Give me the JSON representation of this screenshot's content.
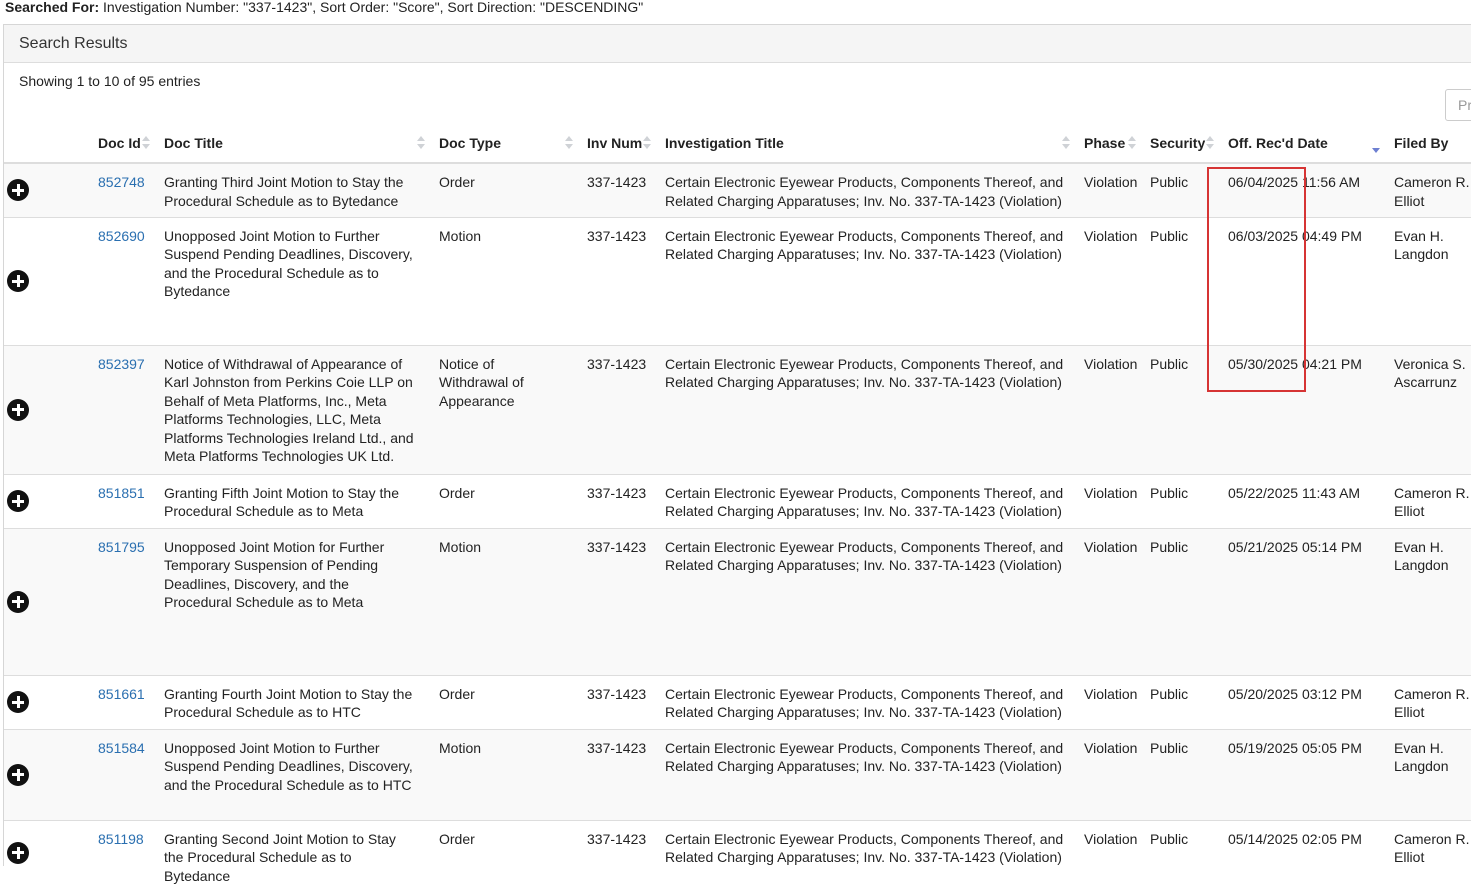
{
  "search_summary": {
    "label": "Searched For:",
    "text": " Investigation Number: \"337-1423\", Sort Order: \"Score\", Sort Direction: \"DESCENDING\""
  },
  "panel": {
    "title": "Search Results",
    "showing": "Showing 1 to 10 of 95 entries",
    "prev_label": "Pr"
  },
  "columns": [
    "Doc Id",
    "Doc Title",
    "Doc Type",
    "Inv Num",
    "Investigation Title",
    "Phase",
    "Security",
    "Off. Rec'd Date",
    "Filed By"
  ],
  "rows": [
    {
      "doc_id": "852748",
      "doc_title": "Granting Third Joint Motion to Stay the Procedural Schedule as to Bytedance",
      "doc_type": "Order",
      "inv_num": "337-1423",
      "inv_title": "Certain Electronic Eyewear Products, Components Thereof, and Related Charging Apparatuses; Inv. No. 337-TA-1423 (Violation)",
      "phase": "Violation",
      "security": "Public",
      "rec_date": "06/04/2025 11:56 AM",
      "filed_by": "Cameron R. Elliot"
    },
    {
      "doc_id": "852690",
      "doc_title": "Unopposed Joint Motion to Further Suspend Pending Deadlines, Discovery, and the Procedural Schedule as to Bytedance",
      "doc_type": "Motion",
      "inv_num": "337-1423",
      "inv_title": "Certain Electronic Eyewear Products, Components Thereof, and Related Charging Apparatuses; Inv. No. 337-TA-1423 (Violation)",
      "phase": "Violation",
      "security": "Public",
      "rec_date": "06/03/2025 04:49 PM",
      "filed_by": "Evan H. Langdon"
    },
    {
      "doc_id": "852397",
      "doc_title": "Notice of Withdrawal of Appearance of Karl Johnston from Perkins Coie LLP on Behalf of Meta Platforms, Inc., Meta Platforms Technologies, LLC, Meta Platforms Technologies Ireland Ltd., and Meta Platforms Technologies UK Ltd.",
      "doc_type": "Notice of Withdrawal of Appearance",
      "inv_num": "337-1423",
      "inv_title": "Certain Electronic Eyewear Products, Components Thereof, and Related Charging Apparatuses; Inv. No. 337-TA-1423 (Violation)",
      "phase": "Violation",
      "security": "Public",
      "rec_date": "05/30/2025 04:21 PM",
      "filed_by": "Veronica S. Ascarrunz"
    },
    {
      "doc_id": "851851",
      "doc_title": "Granting Fifth Joint Motion to Stay the Procedural Schedule as to Meta",
      "doc_type": "Order",
      "inv_num": "337-1423",
      "inv_title": "Certain Electronic Eyewear Products, Components Thereof, and Related Charging Apparatuses; Inv. No. 337-TA-1423 (Violation)",
      "phase": "Violation",
      "security": "Public",
      "rec_date": "05/22/2025 11:43 AM",
      "filed_by": "Cameron R. Elliot"
    },
    {
      "doc_id": "851795",
      "doc_title": "Unopposed Joint Motion for Further Temporary Suspension of Pending Deadlines, Discovery, and the Procedural Schedule as to Meta",
      "doc_type": "Motion",
      "inv_num": "337-1423",
      "inv_title": "Certain Electronic Eyewear Products, Components Thereof, and Related Charging Apparatuses; Inv. No. 337-TA-1423 (Violation)",
      "phase": "Violation",
      "security": "Public",
      "rec_date": "05/21/2025 05:14 PM",
      "filed_by": "Evan H. Langdon"
    },
    {
      "doc_id": "851661",
      "doc_title": "Granting Fourth Joint Motion to Stay the Procedural Schedule as to HTC",
      "doc_type": "Order",
      "inv_num": "337-1423",
      "inv_title": "Certain Electronic Eyewear Products, Components Thereof, and Related Charging Apparatuses; Inv. No. 337-TA-1423 (Violation)",
      "phase": "Violation",
      "security": "Public",
      "rec_date": "05/20/2025 03:12 PM",
      "filed_by": "Cameron R. Elliot"
    },
    {
      "doc_id": "851584",
      "doc_title": "Unopposed Joint Motion to Further Suspend Pending Deadlines, Discovery, and the Procedural Schedule as to HTC",
      "doc_type": "Motion",
      "inv_num": "337-1423",
      "inv_title": "Certain Electronic Eyewear Products, Components Thereof, and Related Charging Apparatuses; Inv. No. 337-TA-1423 (Violation)",
      "phase": "Violation",
      "security": "Public",
      "rec_date": "05/19/2025 05:05 PM",
      "filed_by": "Evan H. Langdon"
    },
    {
      "doc_id": "851198",
      "doc_title": "Granting Second Joint Motion to Stay the Procedural Schedule as to Bytedance",
      "doc_type": "Order",
      "inv_num": "337-1423",
      "inv_title": "Certain Electronic Eyewear Products, Components Thereof, and Related Charging Apparatuses; Inv. No. 337-TA-1423 (Violation)",
      "phase": "Violation",
      "security": "Public",
      "rec_date": "05/14/2025 02:05 PM",
      "filed_by": "Cameron R. Elliot"
    }
  ],
  "colors": {
    "link": "#2a6fb0",
    "highlight": "#d63434",
    "sort_active": "#6d7fd1"
  }
}
